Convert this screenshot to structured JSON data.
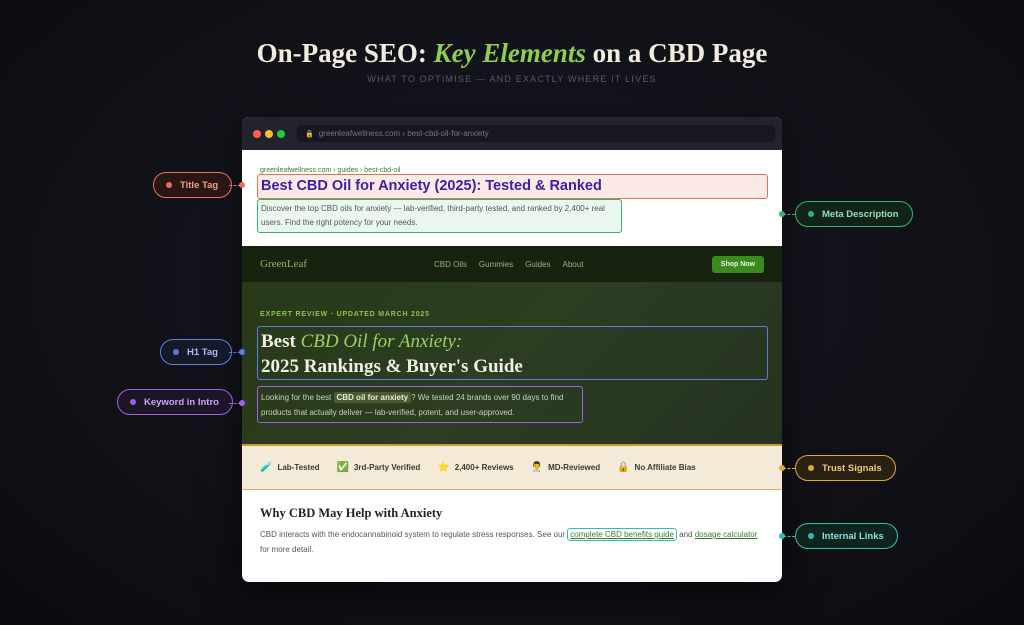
{
  "title": {
    "prefix": "On-Page SEO: ",
    "accent": "Key Elements",
    "suffix": " on a CBD Page"
  },
  "subtitle": "WHAT TO OPTIMISE — AND EXACTLY WHERE IT LIVES",
  "browser": {
    "url": "greenleafwellness.com › best-cbd-oil-for-anxiety"
  },
  "serp": {
    "breadcrumb": "greenleafwellness.com › guides › best-cbd-oil",
    "title": "Best CBD Oil for Anxiety (2025): Tested & Ranked",
    "description": "Discover the top CBD oils for anxiety — lab-verified, third-party tested, and ranked by 2,400+ real users. Find the right potency for your needs."
  },
  "nav": {
    "brand": "GreenLeaf",
    "links": [
      "CBD Oils",
      "Gummies",
      "Guides",
      "About"
    ],
    "cta": "Shop Now"
  },
  "hero": {
    "eyebrow": "EXPERT REVIEW · UPDATED MARCH 2025",
    "h1_part1": "Best ",
    "h1_highlight": "CBD Oil for Anxiety:",
    "h1_line2": "2025 Rankings & Buyer's Guide",
    "intro_before": "Looking for the best ",
    "intro_keyword": "CBD oil for anxiety",
    "intro_after": "? We tested 24 brands over 90 days to find products that actually deliver — lab-verified, potent, and user-approved."
  },
  "trust": [
    {
      "icon": "🧪",
      "icon_name": "test-tube-icon",
      "label": "Lab-Tested"
    },
    {
      "icon": "✅",
      "icon_name": "check-icon",
      "label": "3rd-Party Verified"
    },
    {
      "icon": "⭐",
      "icon_name": "star-icon",
      "label": "2,400+ Reviews"
    },
    {
      "icon": "👨‍⚕️",
      "icon_name": "doctor-icon",
      "label": "MD-Reviewed"
    },
    {
      "icon": "🔒",
      "icon_name": "lock-icon",
      "label": "No Affiliate Bias"
    }
  ],
  "content": {
    "heading": "Why CBD May Help with Anxiety",
    "text_before": "CBD interacts with the endocannabinoid system to regulate stress responses. See our ",
    "link1": "complete CBD benefits guide",
    "text_mid": " and ",
    "link2": "dosage calculator",
    "text_after": " for more detail."
  },
  "labels": {
    "title_tag": "Title Tag",
    "meta_description": "Meta Description",
    "h1_tag": "H1 Tag",
    "keyword_in_intro": "Keyword in Intro",
    "trust_signals": "Trust Signals",
    "internal_links": "Internal Links"
  },
  "colors": {
    "title_tag": "#e0735a",
    "meta_description": "#36b36a",
    "h1_tag": "#5a7de0",
    "keyword_in_intro": "#9c62e0",
    "trust_signals": "#e0a83a",
    "internal_links": "#2fbfb0",
    "accent_green": "#8ccf4f"
  }
}
